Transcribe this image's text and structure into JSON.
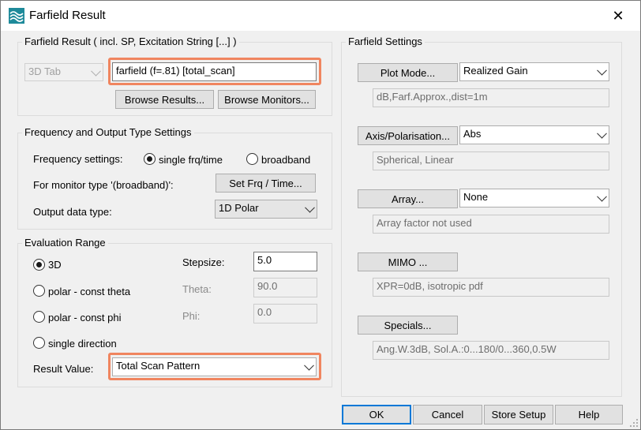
{
  "window": {
    "title": "Farfield Result",
    "close_glyph": "✕"
  },
  "farfield_result": {
    "group_label": "Farfield Result ( incl. SP, Excitation String [...] )",
    "tab_select": "3D Tab",
    "name_value": "farfield (f=.81) [total_scan]",
    "browse_results": "Browse Results...",
    "browse_monitors": "Browse Monitors..."
  },
  "freq_output": {
    "group_label": "Frequency and Output Type Settings",
    "freq_label": "Frequency settings:",
    "freq_options": [
      "single frq/time",
      "broadband"
    ],
    "freq_selected": "single frq/time",
    "monitor_label": "For monitor type '(broadband)':",
    "set_frq_button": "Set Frq / Time...",
    "output_label": "Output data type:",
    "output_value": "1D Polar"
  },
  "evaluation": {
    "group_label": "Evaluation Range",
    "options": [
      "3D",
      "polar - const theta",
      "polar - const phi",
      "single direction"
    ],
    "selected": "3D",
    "stepsize_label": "Stepsize:",
    "stepsize_value": "5.0",
    "theta_label": "Theta:",
    "theta_value": "90.0",
    "phi_label": "Phi:",
    "phi_value": "0.0",
    "result_label": "Result Value:",
    "result_value": "Total Scan Pattern"
  },
  "farfield_settings": {
    "group_label": "Farfield Settings",
    "plot_mode_button": "Plot Mode...",
    "plot_mode_value": "Realized Gain",
    "plot_mode_info": "dB,Farf.Approx.,dist=1m",
    "axis_button": "Axis/Polarisation...",
    "axis_value": "Abs",
    "axis_info": "Spherical, Linear",
    "array_button": "Array...",
    "array_value": "None",
    "array_info": "Array factor not used",
    "mimo_button": "MIMO ...",
    "mimo_info": "XPR=0dB, isotropic pdf",
    "specials_button": "Specials...",
    "specials_info": "Ang.W.3dB, Sol.A.:0...180/0...360,0.5W"
  },
  "footer": {
    "ok": "OK",
    "cancel": "Cancel",
    "store_setup": "Store Setup",
    "help": "Help"
  },
  "colors": {
    "highlight": "#f0855f",
    "default_button_border": "#0078d7",
    "dialog_bg": "#f0f0f0"
  }
}
